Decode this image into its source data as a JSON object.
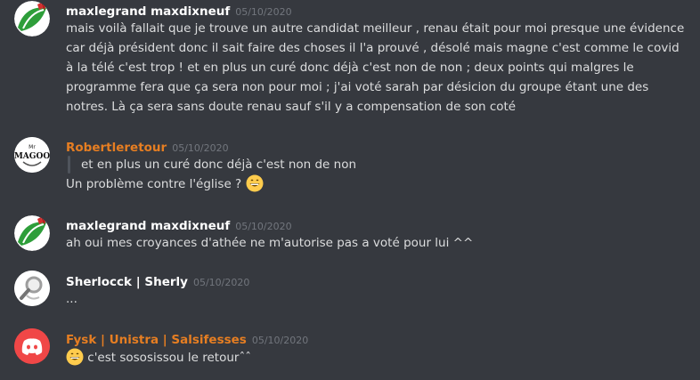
{
  "messages": [
    {
      "author": "maxlegrand maxdixneuf",
      "timestamp": "05/10/2020",
      "lines": [
        "mais voilà fallait que je trouve un autre candidat meilleur , renau était pour moi presque une évidence",
        "car déjà président donc il sait faire des choses il l'a prouvé , désolé mais magne c'est comme le covid",
        "à la télé c'est trop ! et en plus un curé donc déjà c'est non de non ; deux points qui malgres le",
        "programme fera que ça sera non pour moi ; j'ai voté sarah par désicion du groupe étant une des",
        "notres. Là ça sera sans doute renau sauf s'il y a compensation de son coté"
      ]
    },
    {
      "author": "Robertleretour",
      "timestamp": "05/10/2020",
      "avatar_text": "Mr MAGOO",
      "quote": "et en plus un curé donc déjà c'est non de non",
      "text": "Un problème contre l'église ?"
    },
    {
      "author": "maxlegrand maxdixneuf",
      "timestamp": "05/10/2020",
      "text": "ah oui mes croyances d'athée ne m'autorise pas a voté pour lui ^^"
    },
    {
      "author": "Sherlocck | Sherly",
      "timestamp": "05/10/2020",
      "text": "..."
    },
    {
      "author": "Fysk | Unistra | Salsifesses",
      "timestamp": "05/10/2020",
      "text": "c'est sososissou le retourˆˆ"
    }
  ],
  "colors": {
    "background": "#36393f",
    "author_default": "#ffffff",
    "author_orange": "#e67e22",
    "timestamp": "#72767d",
    "discord_blurple": "#f04747"
  },
  "icons": [
    "green-flag-avatar-icon",
    "magoo-avatar-icon",
    "magnifier-avatar-icon",
    "discord-logo-icon",
    "grinning-emoji-icon"
  ]
}
